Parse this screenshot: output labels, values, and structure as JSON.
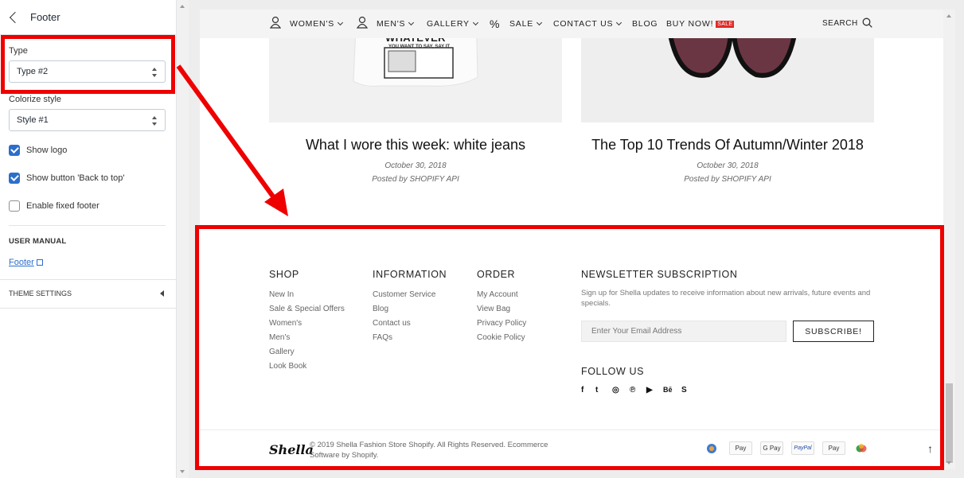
{
  "panel": {
    "title": "Footer",
    "type_label": "Type",
    "type_value": "Type #2",
    "colorize_label": "Colorize style",
    "colorize_value": "Style #1",
    "checkboxes": [
      {
        "label": "Show logo",
        "checked": true
      },
      {
        "label": "Show button 'Back to top'",
        "checked": true
      },
      {
        "label": "Enable fixed footer",
        "checked": false
      }
    ],
    "user_manual_heading": "USER MANUAL",
    "user_manual_link": "Footer",
    "theme_settings": "THEME SETTINGS"
  },
  "nav": {
    "items": [
      "WOMEN'S",
      "MEN'S",
      "GALLERY",
      "SALE",
      "CONTACT US",
      "BLOG",
      "BUY NOW!"
    ],
    "sale_badge": "SALE",
    "search": "SEARCH",
    "percent": "%"
  },
  "posts": [
    {
      "title": "What I wore this week: white jeans",
      "date": "October 30, 2018",
      "author": "Posted by SHOPIFY API",
      "tshirt_line1": "WHATEVER",
      "tshirt_line2": "YOU WANT TO SAY, SAY IT"
    },
    {
      "title": "The Top 10 Trends Of Autumn/Winter 2018",
      "date": "October 30, 2018",
      "author": "Posted by SHOPIFY API"
    }
  ],
  "footer": {
    "shop": {
      "title": "SHOP",
      "links": [
        "New In",
        "Sale & Special Offers",
        "Women's",
        "Men's",
        "Gallery",
        "Look Book"
      ]
    },
    "information": {
      "title": "INFORMATION",
      "links": [
        "Customer Service",
        "Blog",
        "Contact us",
        "FAQs"
      ]
    },
    "order": {
      "title": "ORDER",
      "links": [
        "My Account",
        "View Bag",
        "Privacy Policy",
        "Cookie Policy"
      ]
    },
    "newsletter": {
      "title": "NEWSLETTER SUBSCRIPTION",
      "text": "Sign up for Shella updates to receive information about new arrivals, future events and specials.",
      "placeholder": "Enter Your Email Address",
      "button": "SUBSCRIBE!"
    },
    "follow": {
      "title": "FOLLOW US",
      "icons": [
        "f",
        "t",
        "◎",
        "℗",
        "▶",
        "Bē",
        "S"
      ]
    },
    "logo": "Shella",
    "copyright": "© 2019 Shella Fashion Store Shopify. All Rights Reserved. Ecommerce Software by Shopify.",
    "payments": [
      "",
      "Pay",
      "G Pay",
      "PayPal",
      "Pay",
      ""
    ],
    "to_top": "↑"
  },
  "colors": {
    "annotation": "#ee0000",
    "accent": "#2c6ecb",
    "sale": "#e02b27"
  }
}
